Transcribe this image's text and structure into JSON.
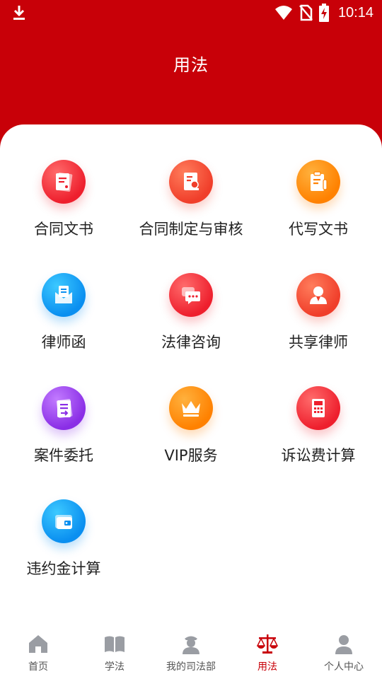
{
  "status_bar": {
    "time": "10:14",
    "icons": [
      "download-icon",
      "wifi-icon",
      "no-sim-icon",
      "battery-charging-icon"
    ]
  },
  "header": {
    "title": "用法"
  },
  "services": [
    {
      "label": "合同文书",
      "icon": "document-icon",
      "color": "#ee1f2d"
    },
    {
      "label": "合同制定与审核",
      "icon": "contract-review-icon",
      "color": "#f03e2a"
    },
    {
      "label": "代写文书",
      "icon": "clipboard-pen-icon",
      "color": "#ff8100"
    },
    {
      "label": "律师函",
      "icon": "letter-icon",
      "color": "#0a8ff0"
    },
    {
      "label": "法律咨询",
      "icon": "chat-icon",
      "color": "#ee1f2d"
    },
    {
      "label": "共享律师",
      "icon": "lawyer-icon",
      "color": "#f03e2a"
    },
    {
      "label": "案件委托",
      "icon": "case-entrust-icon",
      "color": "#8a2ee6"
    },
    {
      "label": "VIP服务",
      "icon": "crown-icon",
      "color": "#ff8100"
    },
    {
      "label": "诉讼费计算",
      "icon": "calculator-icon",
      "color": "#ee1f2d"
    },
    {
      "label": "违约金计算",
      "icon": "wallet-icon",
      "color": "#0a8ff0"
    }
  ],
  "tabbar": {
    "active": "用法",
    "items": [
      {
        "label": "首页",
        "icon": "home-icon"
      },
      {
        "label": "学法",
        "icon": "book-icon"
      },
      {
        "label": "我的司法部",
        "icon": "officer-icon"
      },
      {
        "label": "用法",
        "icon": "scales-icon"
      },
      {
        "label": "个人中心",
        "icon": "person-icon"
      }
    ]
  },
  "colors": {
    "primary": "#c80008",
    "tab_inactive": "#9a9da3"
  }
}
